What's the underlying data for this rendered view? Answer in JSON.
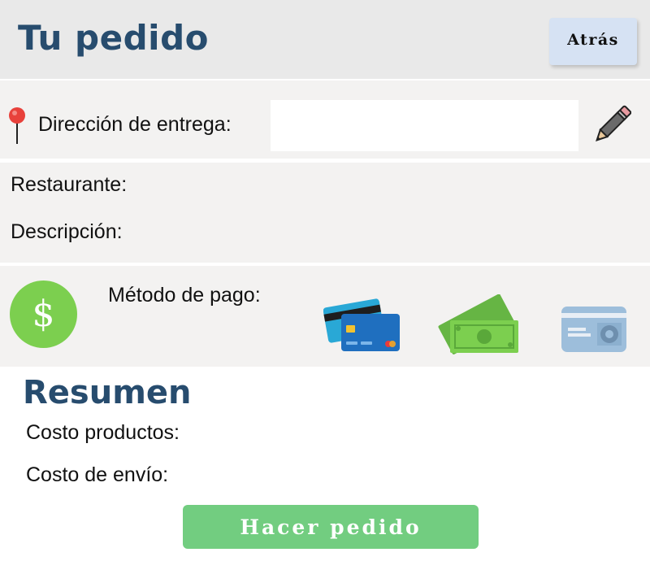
{
  "header": {
    "title": "Tu pedido",
    "back_label": "Atrás"
  },
  "address": {
    "label": "Dirección de entrega:",
    "value": "",
    "placeholder": ""
  },
  "restaurant": {
    "restaurant_label": "Restaurante:",
    "description_label": "Descripción:"
  },
  "payment": {
    "label": "Método de pago:",
    "currency_symbol": "$",
    "options": [
      "credit-cards-icon",
      "cash-icon",
      "debit-card-icon"
    ]
  },
  "summary": {
    "title": "Resumen",
    "products_cost_label": "Costo productos:",
    "shipping_cost_label": "Costo de envío:"
  },
  "actions": {
    "order_label": "Hacer pedido"
  },
  "colors": {
    "accent_title": "#274c6e",
    "order_button": "#72cd80",
    "back_button": "#d6e2f3",
    "dollar_badge": "#7ccf4f"
  }
}
